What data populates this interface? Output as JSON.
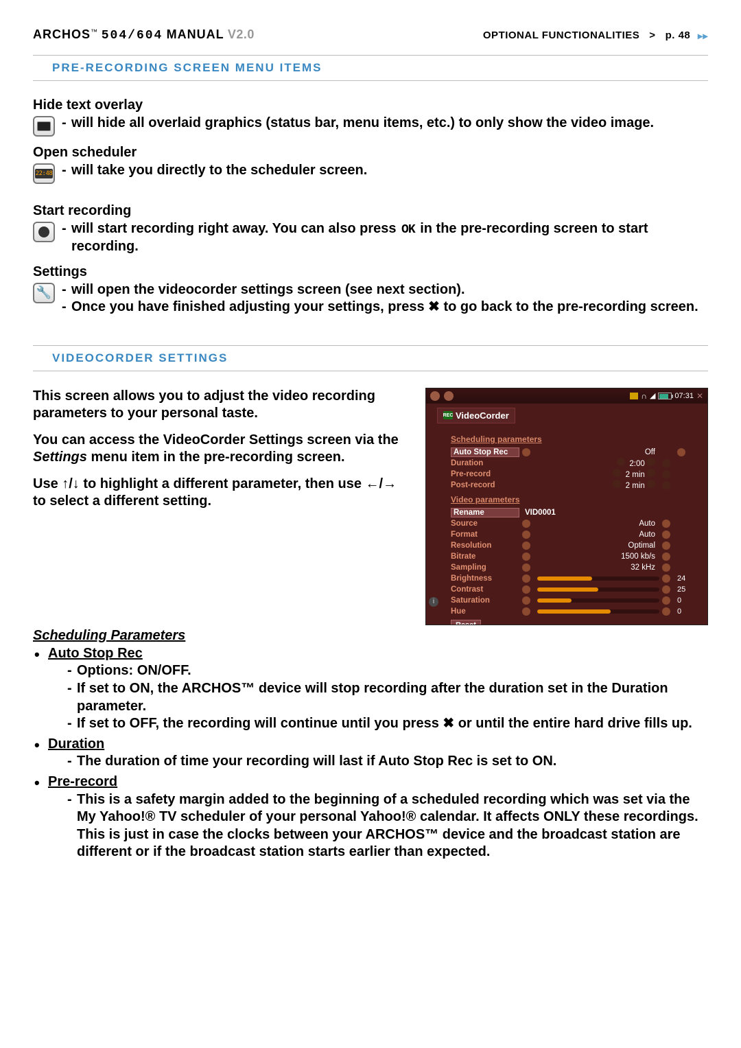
{
  "header": {
    "brand": "ARCHOS",
    "tm": "™",
    "model": "504/604",
    "manual_word": "MANUAL",
    "version": "V2.0",
    "section_path": "OPTIONAL FUNCTIONALITIES",
    "separator": ">",
    "page_label": "p. 48"
  },
  "section1_title": "PRE-RECORDING SCREEN MENU ITEMS",
  "items": {
    "hide": {
      "title": "Hide text overlay",
      "lines": [
        "will hide all overlaid graphics (status bar, menu items, etc.) to only show the video image."
      ]
    },
    "scheduler": {
      "title": "Open scheduler",
      "clock_text": "22:48",
      "lines": [
        "will take you directly to the scheduler screen."
      ]
    },
    "start": {
      "title": "Start recording",
      "lines": [
        "will start recording right away. You can also press OK in the pre-recording screen to start recording."
      ]
    },
    "settings": {
      "title": "Settings",
      "lines": [
        "will open the videocorder settings screen (see next section).",
        "Once you have finished adjusting your settings, press ✖ to go back to the pre-recording screen."
      ]
    }
  },
  "section2_title": "VIDEOCORDER SETTINGS",
  "intro": {
    "p1": "This screen allows you to adjust the video recording parameters to your personal taste.",
    "p2_pre": "You can access the VideoCorder Settings screen via the ",
    "p2_em": "Settings",
    "p2_post": " menu item in the pre-recording screen.",
    "p3": "Use ↑/↓ to highlight a different parameter, then use ←/→ to select a different setting."
  },
  "sched_heading": "Scheduling Parameters",
  "params": {
    "auto": {
      "name": "Auto Stop Rec",
      "dashes": [
        "Options: ON/OFF.",
        "If set to ON, the ARCHOS™ device will stop recording after the duration set in the Duration parameter.",
        "If set to OFF, the recording will continue until you press ✖ or until the entire hard drive fills up."
      ]
    },
    "duration": {
      "name": "Duration",
      "dashes": [
        "The duration of time your recording will last if Auto Stop Rec is set to ON."
      ]
    },
    "prerecord": {
      "name": "Pre-record",
      "dashes": [
        "This is a safety margin added to the beginning of a scheduled recording which was set via the My Yahoo!® TV scheduler of your personal Yahoo!® calendar. It affects ONLY these recordings. This is just in case the clocks between your ARCHOS™ device and the broadcast station are different or if the broadcast station starts earlier than expected."
      ]
    }
  },
  "vc": {
    "time": "07:31",
    "title": "VideoCorder",
    "section_sched": "Scheduling parameters",
    "section_video": "Video parameters",
    "rows_sched": [
      {
        "label": "Auto Stop Rec",
        "value": "Off"
      },
      {
        "label": "Duration",
        "value": "2:00"
      },
      {
        "label": "Pre-record",
        "value": "2 min"
      },
      {
        "label": "Post-record",
        "value": "2 min"
      }
    ],
    "rows_video": [
      {
        "label": "Rename",
        "name": "VID0001"
      },
      {
        "label": "Source",
        "value": "Auto"
      },
      {
        "label": "Format",
        "value": "Auto"
      },
      {
        "label": "Resolution",
        "value": "Optimal"
      },
      {
        "label": "Bitrate",
        "value": "1500 kb/s"
      },
      {
        "label": "Sampling",
        "value": "32 kHz"
      },
      {
        "label": "Brightness",
        "slider": 45,
        "num": "24"
      },
      {
        "label": "Contrast",
        "slider": 50,
        "num": "25"
      },
      {
        "label": "Saturation",
        "slider": 28,
        "num": "0"
      },
      {
        "label": "Hue",
        "slider": 60,
        "num": "0"
      }
    ],
    "reset": "Reset"
  }
}
